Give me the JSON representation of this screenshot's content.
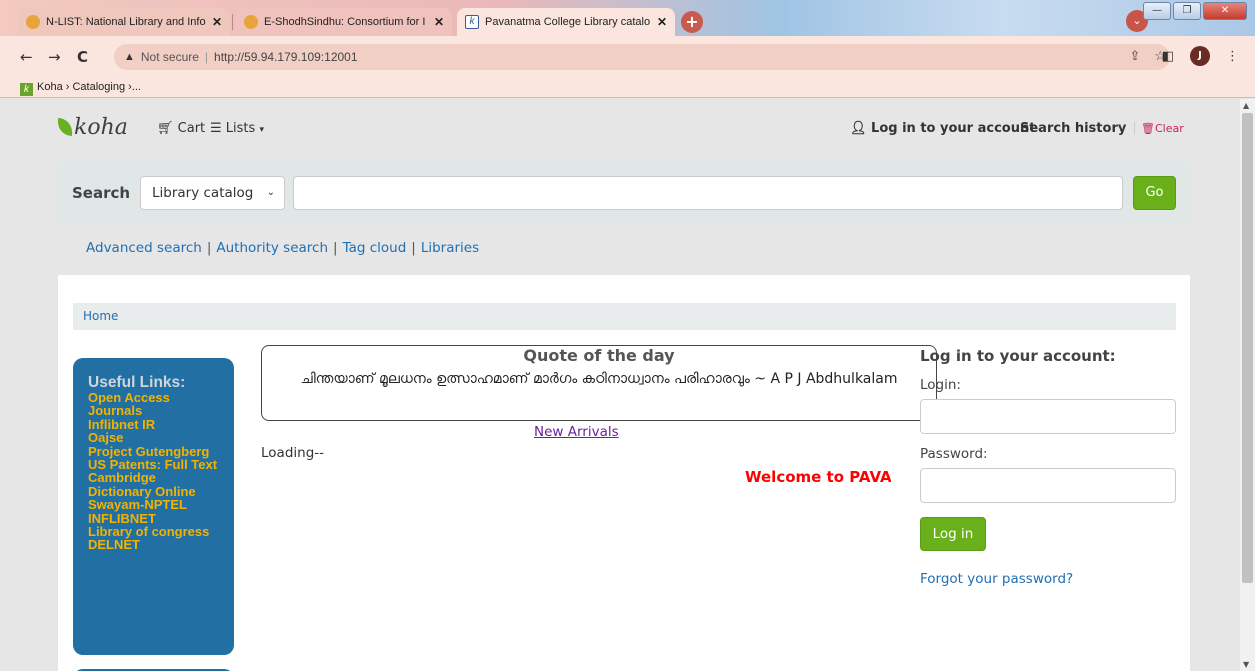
{
  "browser": {
    "tabs": [
      {
        "title": "N-LIST: National Library and Info"
      },
      {
        "title": "E-ShodhSindhu: Consortium for I"
      },
      {
        "title": "Pavanatma College Library catalo"
      }
    ],
    "url_status": "Not secure",
    "url": "http://59.94.179.109:12001",
    "bookmark": "Koha › Cataloging ›...",
    "profile_initial": "J",
    "new_tab": "+"
  },
  "header": {
    "logo": "koha",
    "cart": "Cart",
    "lists": "Lists",
    "login": "Log in to your account",
    "search_history": "Search history",
    "clear": "Clear"
  },
  "search": {
    "label": "Search",
    "scope": "Library catalog",
    "query": "",
    "go": "Go"
  },
  "sublinks": {
    "advanced": "Advanced search",
    "authority": "Authority search",
    "tagcloud": "Tag cloud",
    "libraries": "Libraries"
  },
  "breadcrumb": "Home",
  "useful_links": {
    "title": "Useful Links:",
    "items": [
      "Open Access Journals",
      "Inflibnet IR",
      "Oajse",
      "Project Gutengberg",
      "US Patents: Full Text",
      "Cambridge Dictionary Online",
      "Swayam-NPTEL",
      "INFLIBNET",
      "Library of congress",
      "DELNET"
    ]
  },
  "quote": {
    "title": "Quote of the day",
    "text": "ചിന്തയാണ് മൂലധനം ഉത്സാഹമാണ് മാർഗം കഠിനാധ്വാനം പരിഹാരവും ~ A P J Abdhulkalam"
  },
  "new_arrivals": "New Arrivals",
  "loading": "Loading--",
  "welcome": "Welcome to PAVA",
  "login_panel": {
    "title": "Log in to your account:",
    "login_label": "Login:",
    "password_label": "Password:",
    "submit": "Log in",
    "forgot": "Forgot your password?"
  }
}
